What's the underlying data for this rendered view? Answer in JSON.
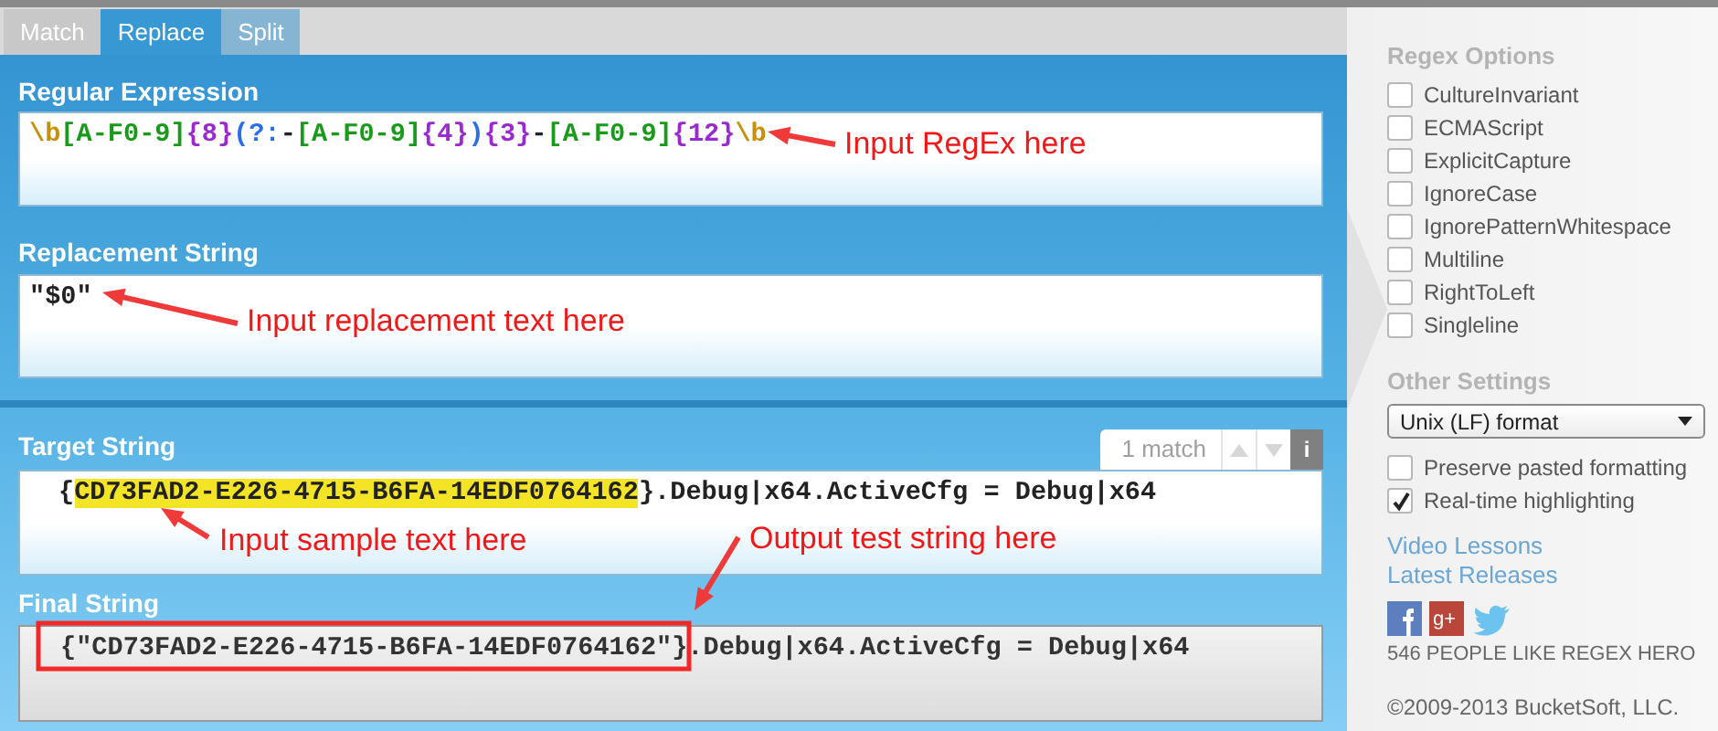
{
  "tabs": [
    {
      "label": "Match",
      "selected": false
    },
    {
      "label": "Replace",
      "selected": true
    },
    {
      "label": "Split",
      "selected": false
    }
  ],
  "regex": {
    "label": "Regular Expression",
    "tokens": [
      {
        "text": "\\b",
        "kind": "anchor"
      },
      {
        "text": "[A-F0-9]",
        "kind": "class"
      },
      {
        "text": "{8}",
        "kind": "quantifier"
      },
      {
        "text": "(?:",
        "kind": "group"
      },
      {
        "text": "-",
        "kind": "literal"
      },
      {
        "text": "[A-F0-9]",
        "kind": "class"
      },
      {
        "text": "{4}",
        "kind": "quantifier"
      },
      {
        "text": ")",
        "kind": "group"
      },
      {
        "text": "{3}",
        "kind": "quantifier"
      },
      {
        "text": "-",
        "kind": "literal"
      },
      {
        "text": "[A-F0-9]",
        "kind": "class"
      },
      {
        "text": "{12}",
        "kind": "quantifier"
      },
      {
        "text": "\\b",
        "kind": "anchor"
      }
    ]
  },
  "replacement": {
    "label": "Replacement String",
    "value": "\"$0\""
  },
  "target": {
    "label": "Target String",
    "match_count": "1 match",
    "info_button": "i",
    "segments": [
      {
        "text": "{",
        "highlighted": false
      },
      {
        "text": "CD73FAD2-E226-4715-B6FA-14EDF0764162",
        "highlighted": true
      },
      {
        "text": "}.Debug|x64.ActiveCfg = Debug|x64",
        "highlighted": false
      }
    ]
  },
  "final": {
    "label": "Final String",
    "value": "{\"CD73FAD2-E226-4715-B6FA-14EDF0764162\"}.Debug|x64.ActiveCfg = Debug|x64"
  },
  "regex_options": {
    "title": "Regex Options",
    "options": [
      {
        "label": "CultureInvariant",
        "checked": false
      },
      {
        "label": "ECMAScript",
        "checked": false
      },
      {
        "label": "ExplicitCapture",
        "checked": false
      },
      {
        "label": "IgnoreCase",
        "checked": false
      },
      {
        "label": "IgnorePatternWhitespace",
        "checked": false
      },
      {
        "label": "Multiline",
        "checked": false
      },
      {
        "label": "RightToLeft",
        "checked": false
      },
      {
        "label": "Singleline",
        "checked": false
      }
    ]
  },
  "other_settings": {
    "title": "Other Settings",
    "line_ending": "Unix (LF) format",
    "options": [
      {
        "label": "Preserve pasted formatting",
        "checked": false
      },
      {
        "label": "Real-time highlighting",
        "checked": true
      }
    ]
  },
  "links": [
    "Video Lessons",
    "Latest Releases"
  ],
  "google_plus_label": "g+",
  "likes": "546 PEOPLE LIKE REGEX HERO",
  "copyright": "©2009-2013 BucketSoft, LLC.",
  "annotations": [
    {
      "text": "Input RegEx here"
    },
    {
      "text": "Input replacement text here"
    },
    {
      "text": "Input sample text here"
    },
    {
      "text": "Output test string here"
    }
  ]
}
